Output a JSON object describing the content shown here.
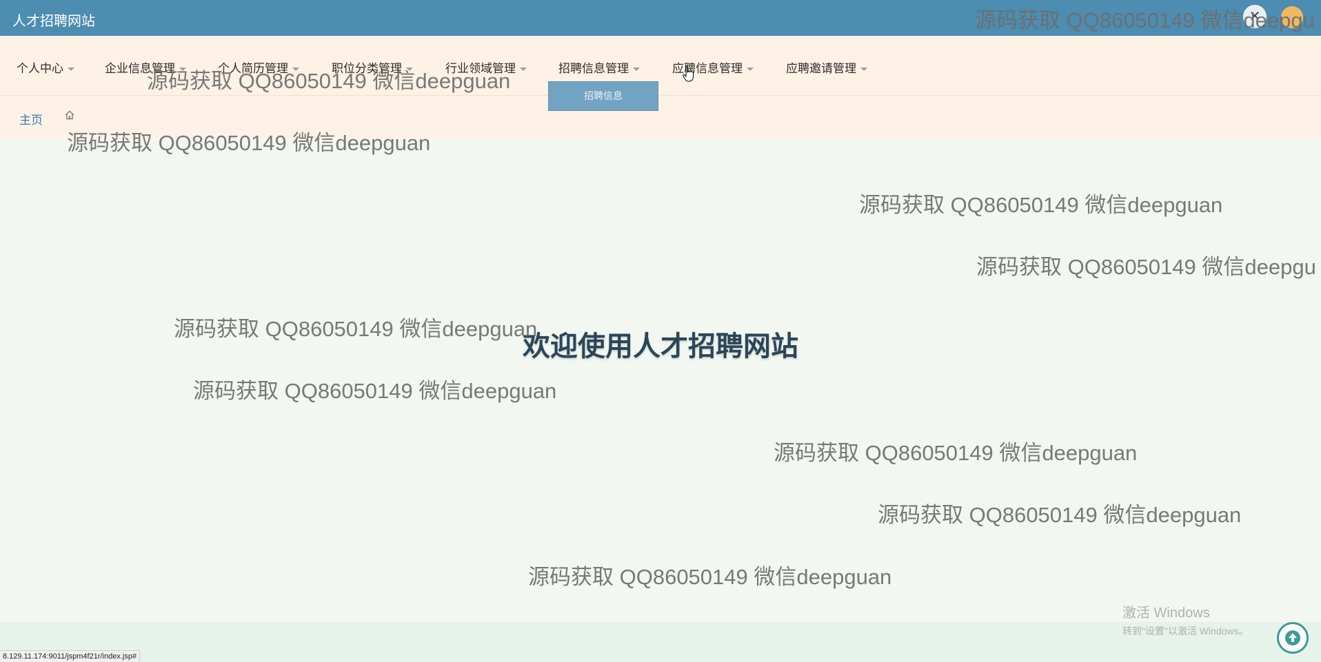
{
  "header": {
    "app_title": "人才招聘网站",
    "close_symbol": "✕"
  },
  "nav": {
    "items": [
      {
        "label": "个人中心"
      },
      {
        "label": "企业信息管理"
      },
      {
        "label": "个人简历管理"
      },
      {
        "label": "职位分类管理"
      },
      {
        "label": "行业领域管理"
      },
      {
        "label": "招聘信息管理"
      },
      {
        "label": "应聘信息管理"
      },
      {
        "label": "应聘邀请管理"
      }
    ],
    "dropdown_open": {
      "parent": "招聘信息管理",
      "items": [
        {
          "label": "招聘信息"
        }
      ]
    }
  },
  "breadcrumb": {
    "home": "主页",
    "icon": "home-icon"
  },
  "main": {
    "welcome": "欢迎使用人才招聘网站"
  },
  "watermark": {
    "text": "源码获取 QQ86050149 微信deepguan",
    "truncated_text": "源码获取 QQ86050149 微信deepgu"
  },
  "system": {
    "activate_line1": "激活 Windows",
    "activate_line2": "转到\"设置\"以激活 Windows。",
    "status_url": "8.129.11.174:9011/jspm4f21r/index.jsp#"
  },
  "colors": {
    "topbar": "#4d8db1",
    "navbar": "#fef1e5",
    "main_bg": "#f2f8f1",
    "dropdown": "#72a3c2",
    "welcome": "#2b4659"
  }
}
